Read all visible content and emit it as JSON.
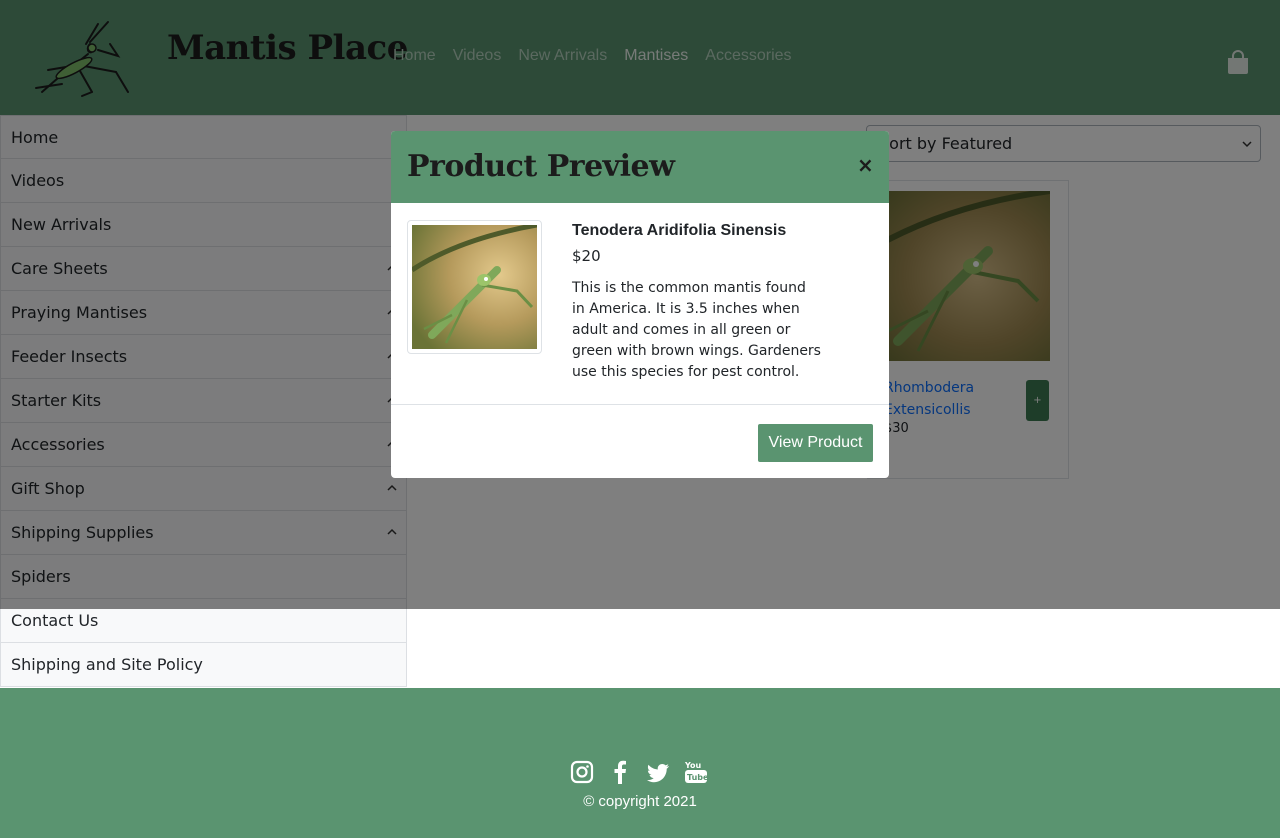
{
  "brand": {
    "name": "Mantis Place",
    "logo_icon": "mantis-logo-icon"
  },
  "nav": {
    "items": [
      {
        "label": "Home",
        "active": false
      },
      {
        "label": "Videos",
        "active": false
      },
      {
        "label": "New Arrivals",
        "active": false
      },
      {
        "label": "Mantises",
        "active": true
      },
      {
        "label": "Accessories",
        "active": false
      }
    ],
    "cart_icon": "shopping-bag-icon"
  },
  "sidebar": {
    "items": [
      {
        "label": "Home",
        "expandable": false
      },
      {
        "label": "Videos",
        "expandable": false
      },
      {
        "label": "New Arrivals",
        "expandable": false
      },
      {
        "label": "Care Sheets",
        "expandable": true
      },
      {
        "label": "Praying Mantises",
        "expandable": true
      },
      {
        "label": "Feeder Insects",
        "expandable": true
      },
      {
        "label": "Starter Kits",
        "expandable": true
      },
      {
        "label": "Accessories",
        "expandable": true
      },
      {
        "label": "Gift Shop",
        "expandable": true
      },
      {
        "label": "Shipping Supplies",
        "expandable": true
      },
      {
        "label": "Spiders",
        "expandable": false
      },
      {
        "label": "Contact Us",
        "expandable": false
      },
      {
        "label": "Shipping and Site Policy",
        "expandable": false
      }
    ]
  },
  "main": {
    "sort": {
      "selected": "Sort by Featured"
    },
    "cards": [
      {
        "name": "Rhombodera Extensicollis",
        "price": "$30",
        "add_label": "+"
      }
    ]
  },
  "modal": {
    "title": "Product Preview",
    "close_label": "×",
    "product": {
      "name": "Tenodera Aridifolia Sinensis",
      "price": "$20",
      "description": "This is the common mantis found in America. It is 3.5 inches when adult and comes in all green or green with brown wings. Gardeners use this species for pest control."
    },
    "view_button": "View Product"
  },
  "footer": {
    "social_icons": [
      "instagram-icon",
      "facebook-icon",
      "twitter-icon",
      "youtube-icon"
    ],
    "copyright": "© copyright 2021"
  },
  "colors": {
    "header_bg": "#5a9470",
    "footer_bg": "#5a9470",
    "overlay": "rgba(0,0,0,0.5)",
    "link_blue": "#0d6efd",
    "button_green": "#5a9470"
  }
}
